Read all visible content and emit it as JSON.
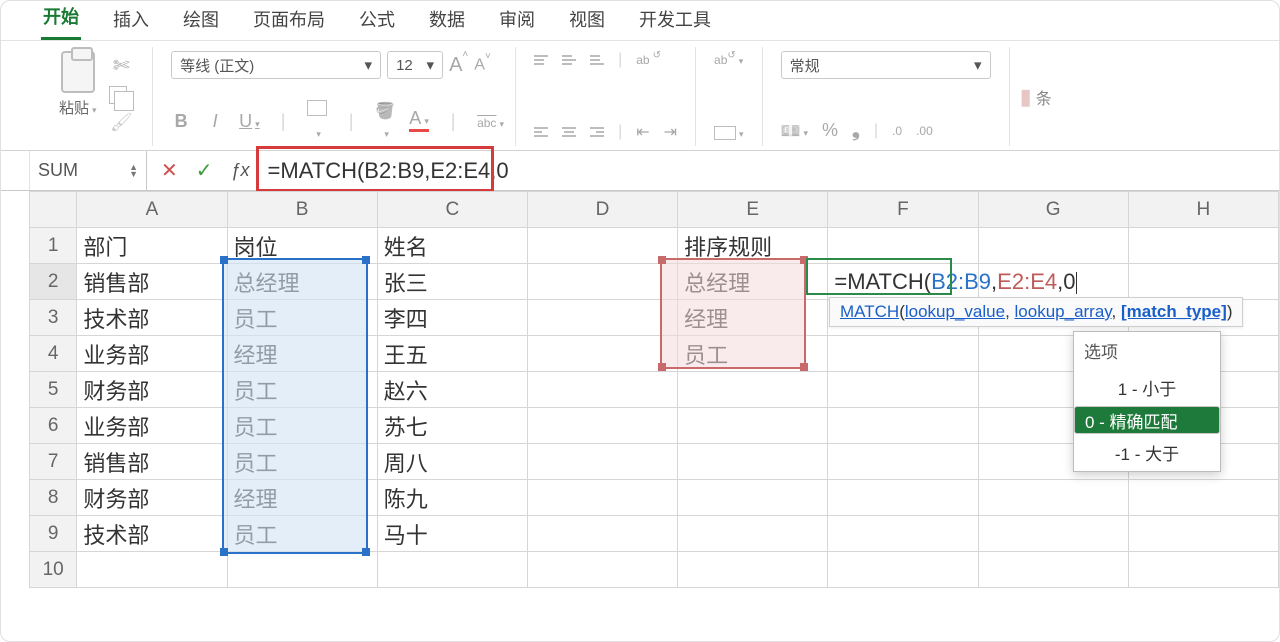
{
  "tabs": {
    "items": [
      "开始",
      "插入",
      "绘图",
      "页面布局",
      "公式",
      "数据",
      "审阅",
      "视图",
      "开发工具"
    ],
    "active_index": 0
  },
  "ribbon": {
    "paste_label": "粘贴",
    "font_name": "等线 (正文)",
    "font_size": "12",
    "number_format": "常规",
    "extra_label": "条"
  },
  "formula_bar": {
    "namebox": "SUM",
    "formula_text": "=MATCH(B2:B9,E2:E4,0"
  },
  "columns": [
    "A",
    "B",
    "C",
    "D",
    "E",
    "F",
    "G",
    "H"
  ],
  "row_numbers": [
    1,
    2,
    3,
    4,
    5,
    6,
    7,
    8,
    9,
    10
  ],
  "cells": {
    "headers": {
      "A": "部门",
      "B": "岗位",
      "C": "姓名",
      "E": "排序规则"
    },
    "rows": [
      {
        "A": "销售部",
        "B": "总经理",
        "C": "张三",
        "E": "总经理"
      },
      {
        "A": "技术部",
        "B": "员工",
        "C": "李四",
        "E": "经理"
      },
      {
        "A": "业务部",
        "B": "经理",
        "C": "王五",
        "E": "员工"
      },
      {
        "A": "财务部",
        "B": "员工",
        "C": "赵六"
      },
      {
        "A": "业务部",
        "B": "员工",
        "C": "苏七"
      },
      {
        "A": "销售部",
        "B": "员工",
        "C": "周八"
      },
      {
        "A": "财务部",
        "B": "经理",
        "C": "陈九"
      },
      {
        "A": "技术部",
        "B": "员工",
        "C": "马十"
      }
    ],
    "F2_formula": {
      "prefix": "=",
      "fn": "MATCH",
      "arg1": "B2:B9",
      "arg2": "E2:E4",
      "arg3": "0"
    }
  },
  "tooltip": {
    "fn": "MATCH",
    "args": [
      "lookup_value",
      "lookup_array",
      "[match_type]"
    ]
  },
  "autocomplete": {
    "header": "选项",
    "options": [
      "1 - 小于",
      "0 - 精确匹配",
      "-1 - 大于"
    ],
    "selected_index": 1
  }
}
